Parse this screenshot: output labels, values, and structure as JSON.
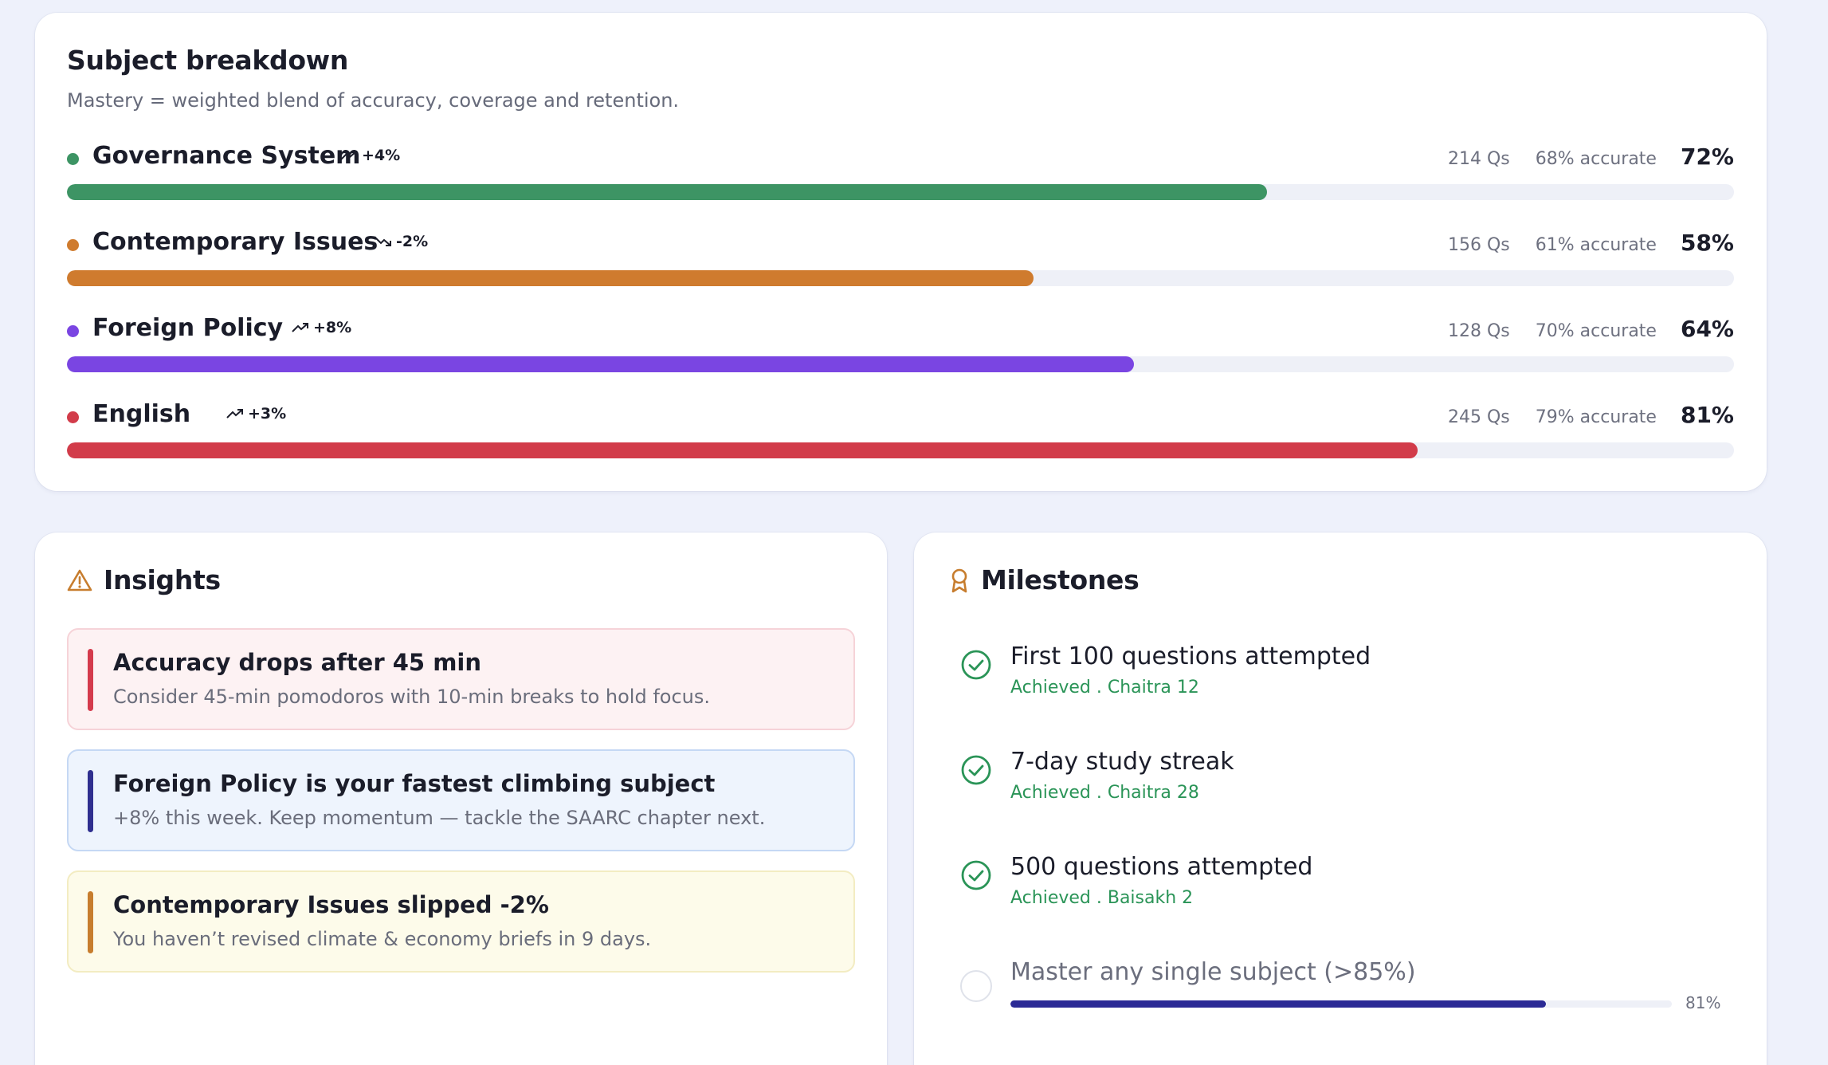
{
  "breakdown": {
    "title": "Subject breakdown",
    "subtitle": "Mastery = weighted blend of accuracy, coverage and retention.",
    "subjects": [
      {
        "name": "Governance System",
        "trend": "+4%",
        "trend_dir": "up",
        "questions": "214 Qs",
        "accuracy": "68% accurate",
        "mastery": "72%",
        "progress": 0.72,
        "color": "#3d9464"
      },
      {
        "name": "Contemporary Issues",
        "trend": "-2%",
        "trend_dir": "down",
        "questions": "156 Qs",
        "accuracy": "61% accurate",
        "mastery": "58%",
        "progress": 0.58,
        "color": "#cf7b2e"
      },
      {
        "name": "Foreign Policy",
        "trend": "+8%",
        "trend_dir": "up",
        "questions": "128 Qs",
        "accuracy": "70% accurate",
        "mastery": "64%",
        "progress": 0.64,
        "color": "#7a45e2"
      },
      {
        "name": "English",
        "trend": "+3%",
        "trend_dir": "up",
        "questions": "245 Qs",
        "accuracy": "79% accurate",
        "mastery": "81%",
        "progress": 0.81,
        "color": "#d23c4a"
      }
    ]
  },
  "insights": {
    "title": "Insights",
    "icon": "warning-triangle-icon",
    "items": [
      {
        "title": "Accuracy drops after 45 min",
        "desc": "Consider 45-min pomodoros with 10-min breaks to hold focus.",
        "accent": "#d43b4c"
      },
      {
        "title": "Foreign Policy is your fastest climbing subject",
        "desc": "+8% this week. Keep momentum — tackle the SAARC chapter next.",
        "accent": "#2f2f8f"
      },
      {
        "title": "Contemporary Issues slipped -2%",
        "desc": "You haven’t revised climate & economy briefs in 9 days.",
        "accent": "#c77d2e"
      }
    ]
  },
  "milestones": {
    "title": "Milestones",
    "icon": "award-ribbon-icon",
    "items": [
      {
        "title": "First 100 questions attempted",
        "status": "Achieved . Chaitra 12",
        "done": true
      },
      {
        "title": "7-day study streak",
        "status": "Achieved . Chaitra 28",
        "done": true
      },
      {
        "title": "500 questions attempted",
        "status": "Achieved . Baisakh 2",
        "done": true
      },
      {
        "title": "Master any single subject (>85%)",
        "progress_label": "81%",
        "progress": 0.81,
        "done": false
      }
    ]
  }
}
